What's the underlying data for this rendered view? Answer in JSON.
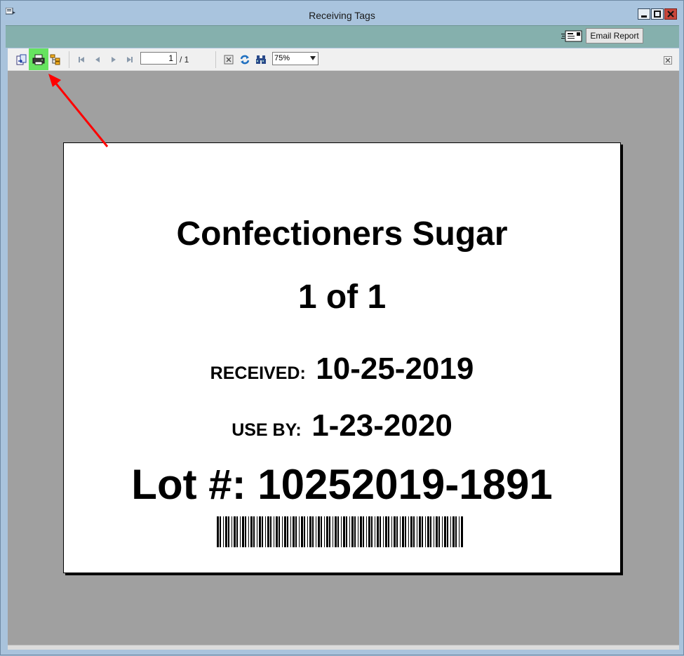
{
  "window": {
    "title": "Receiving Tags"
  },
  "header": {
    "email_button_label": "Email Report",
    "email_icon": "envelope-report-icon"
  },
  "toolbar": {
    "export_icon": "export-icon",
    "print_icon": "print-icon",
    "group_tree_icon": "group-tree-icon",
    "first_page_icon": "first-page-icon",
    "prev_page_icon": "previous-page-icon",
    "next_page_icon": "next-page-icon",
    "last_page_icon": "last-page-icon",
    "current_page": "1",
    "page_total": "/ 1",
    "stop_icon": "stop-icon",
    "refresh_icon": "refresh-icon",
    "search_icon": "binoculars-icon",
    "zoom": "75%",
    "close_view_icon": "close-icon",
    "highlight_color": "#66e35f"
  },
  "tag": {
    "product": "Confectioners Sugar",
    "count": "1 of 1",
    "received_label": "RECEIVED:",
    "received_date": "10-25-2019",
    "use_by_label": "USE BY:",
    "use_by_date": "1-23-2020",
    "lot": "Lot #: 10252019-1891"
  },
  "annotation": {
    "arrow_color": "#ff0000"
  }
}
